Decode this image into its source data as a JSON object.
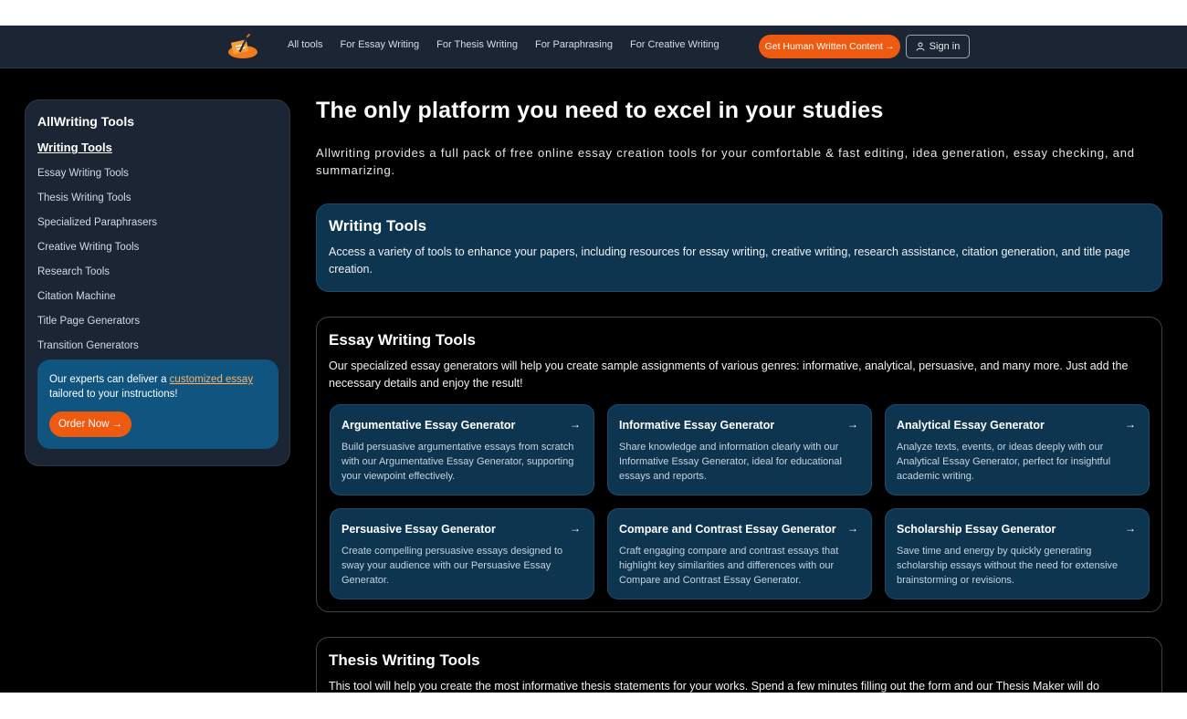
{
  "header": {
    "nav": [
      "All tools",
      "For Essay Writing",
      "For Thesis Writing",
      "For Paraphrasing",
      "For Creative Writing"
    ],
    "cta_label": "Get Human Written Content",
    "signin_label": "Sign in",
    "accent_color": "#ef5a11"
  },
  "sidebar": {
    "title": "AllWriting Tools",
    "active": "Writing Tools",
    "items": [
      "Essay Writing Tools",
      "Thesis Writing Tools",
      "Specialized Paraphrasers",
      "Creative Writing Tools",
      "Research Tools",
      "Citation Machine",
      "Title Page Generators",
      "Transition Generators"
    ],
    "promo": {
      "text_before": "Our experts can deliver a ",
      "link": "customized essay",
      "text_after": " tailored to your instructions!",
      "button": "Order Now"
    }
  },
  "main": {
    "heading": "The only platform you need to excel in your studies",
    "intro": "Allwriting provides a full pack of free online essay creation tools for your comfortable & fast editing, idea generation, essay checking, and summarizing.",
    "writing_tools": {
      "title": "Writing Tools",
      "desc": "Access a variety of tools to enhance your papers, including resources for essay writing, creative writing, research assistance, citation generation, and title page creation."
    },
    "essay_tools": {
      "title": "Essay Writing Tools",
      "desc": "Our specialized essay generators will help you create sample assignments of various genres: informative, analytical, persuasive, and many more. Just add the necessary details and enjoy the result!",
      "cards": [
        {
          "title": "Argumentative Essay Generator",
          "desc": "Build persuasive argumentative essays from scratch with our Argumentative Essay Generator, supporting your viewpoint effectively."
        },
        {
          "title": "Informative Essay Generator",
          "desc": "Share knowledge and information clearly with our Informative Essay Generator, ideal for educational essays and reports."
        },
        {
          "title": "Analytical Essay Generator",
          "desc": "Analyze texts, events, or ideas deeply with our Analytical Essay Generator, perfect for insightful academic writing."
        },
        {
          "title": "Persuasive Essay Generator",
          "desc": "Create compelling persuasive essays designed to sway your audience with our Persuasive Essay Generator."
        },
        {
          "title": "Compare and Contrast Essay Generator",
          "desc": "Craft engaging compare and contrast essays that highlight key similarities and differences with our Compare and Contrast Essay Generator."
        },
        {
          "title": "Scholarship Essay Generator",
          "desc": "Save time and energy by quickly generating scholarship essays without the need for extensive brainstorming or revisions."
        }
      ]
    },
    "thesis_tools": {
      "title": "Thesis Writing Tools",
      "desc": "This tool will help you create the most informative thesis statements for your works. Spend a few minutes filling out the form and our Thesis Maker will do"
    }
  }
}
